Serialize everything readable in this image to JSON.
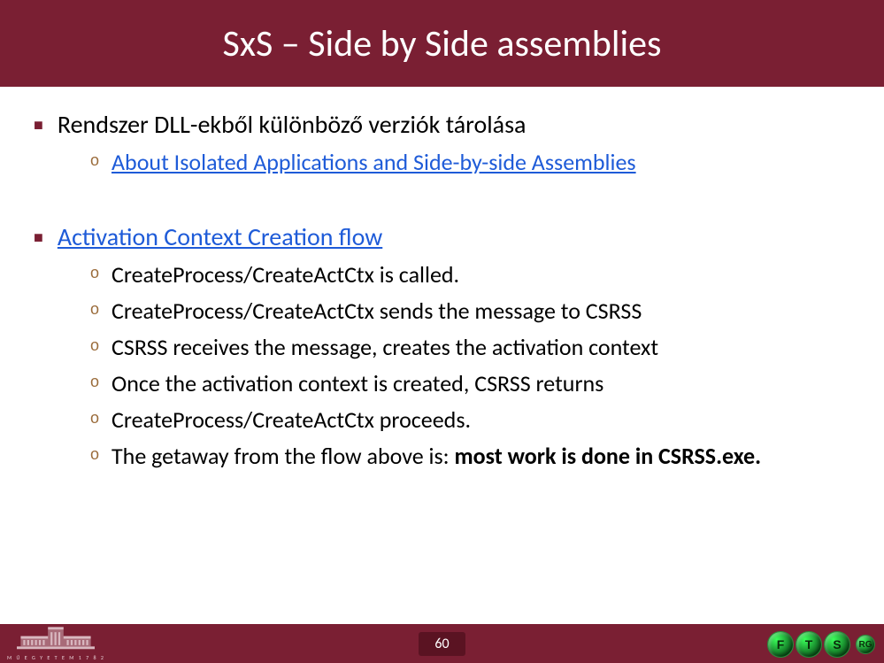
{
  "title": "SxS – Side by Side assemblies",
  "bullets": [
    {
      "text": "Rendszer DLL-ekből különböző verziók tárolása",
      "link": false,
      "subs": [
        {
          "text": "About Isolated Applications and Side-by-side Assemblies",
          "link": true
        }
      ]
    },
    {
      "text": "Activation Context Creation flow",
      "link": true,
      "subs": [
        {
          "text": "CreateProcess/CreateActCtx is called."
        },
        {
          "text": "CreateProcess/CreateActCtx sends the message to CSRSS"
        },
        {
          "text": "CSRSS receives the message, creates the activation context"
        },
        {
          "text": "Once the activation context is created, CSRSS returns"
        },
        {
          "text": "CreateProcess/CreateActCtx proceeds."
        },
        {
          "prefix": "The getaway from the flow above is: ",
          "bold": "most work is done in CSRSS.exe."
        }
      ]
    }
  ],
  "page": "60",
  "uni": "M Ű E G Y E T E M   1 7 8 2",
  "logos": {
    "a": "F",
    "b": "T",
    "c": "S",
    "d": "RG"
  }
}
